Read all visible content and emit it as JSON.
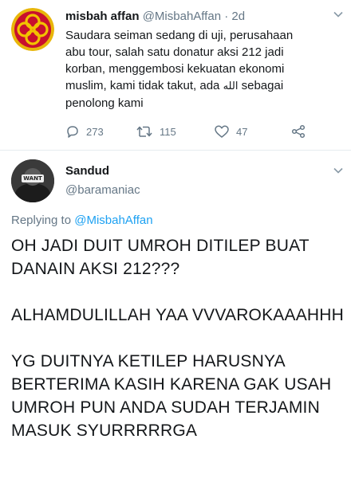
{
  "parent_tweet": {
    "name": "misbah affan",
    "handle": "@MisbahAffan",
    "time": "· 2d",
    "text_line1": "Saudara seiman sedang di uji, perusahaan",
    "text_line2": "abu tour, salah satu donatur aksi 212 jadi",
    "text_line3": "korban, menggembosi kekuatan ekonomi",
    "text_line4_a": "muslim, kami tidak takut, ada ",
    "text_line4_arabic": "الله",
    "text_line4_b": " sebagai",
    "text_line5": "penolong kami",
    "reply_count": "273",
    "retweet_count": "115",
    "like_count": "47",
    "icons": [
      "chevron-down-icon",
      "reply-icon",
      "retweet-icon",
      "like-icon",
      "share-icon"
    ],
    "accent_color": "#f2b705"
  },
  "reply_tweet": {
    "name": "Sandud",
    "handle": "@baramaniac",
    "avatar_text": "WANT",
    "replying_prefix": "Replying to ",
    "replying_mention": "@MisbahAffan",
    "body": [
      "OH JADI DUIT UMROH DITILEP BUAT DANAIN AKSI 212???",
      "ALHAMDULILLAH YAA VVVAROKAAAHHH",
      "YG DUITNYA KETILEP HARUSNYA BERTERIMA KASIH KARENA GAK USAH UMROH PUN ANDA SUDAH TERJAMIN MASUK SYURRRRRGA"
    ],
    "mention_color": "#1da1f2"
  }
}
